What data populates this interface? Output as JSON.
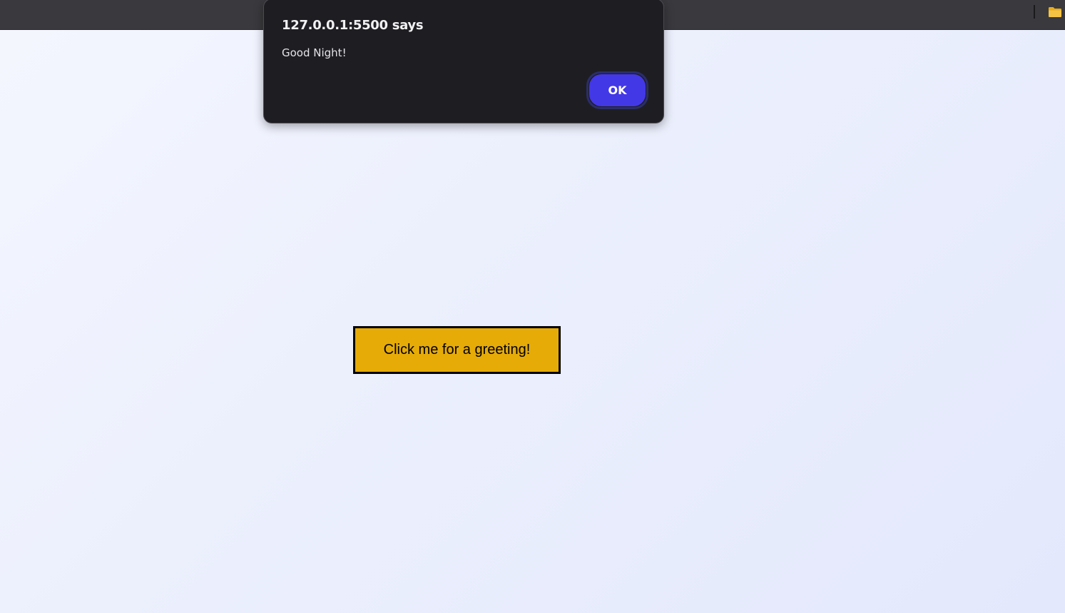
{
  "browser": {
    "toolbar_icon": "folder-icon",
    "toolbar_icon_color": "#f6c445"
  },
  "page": {
    "button_label": "Click me for a greeting!",
    "button_color": "#e6ab07"
  },
  "dialog": {
    "title": "127.0.0.1:5500 says",
    "message": "Good Night!",
    "ok_label": "OK",
    "ok_color": "#4338e6"
  }
}
